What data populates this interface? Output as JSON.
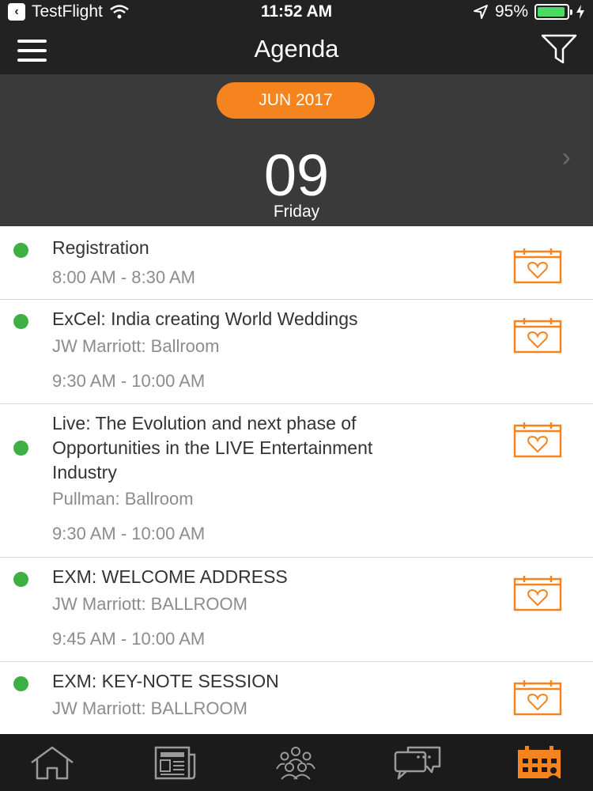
{
  "status_bar": {
    "carrier": "TestFlight",
    "time": "11:52 AM",
    "battery": "95%",
    "battery_level": 0.95,
    "icons": [
      "back-icon",
      "wifi-icon",
      "location-icon",
      "battery-icon",
      "charging-icon"
    ]
  },
  "header": {
    "title": "Agenda",
    "menu_icon": "hamburger-icon",
    "filter_icon": "funnel-icon"
  },
  "date_selector": {
    "month": "JUN 2017",
    "day": "09",
    "weekday": "Friday",
    "next_icon": "chevron-right-icon"
  },
  "agenda": [
    {
      "title": "Registration",
      "venue": "",
      "time": "8:00 AM - 8:30 AM"
    },
    {
      "title": "ExCel: India creating World Weddings",
      "venue": "JW Marriott: Ballroom",
      "time": "9:30 AM - 10:00 AM"
    },
    {
      "title_lines": [
        "Live: The Evolution and next phase of",
        "Opportunities in the LIVE Entertainment",
        "Industry"
      ],
      "venue": "Pullman: Ballroom",
      "time": "9:30 AM - 10:00 AM"
    },
    {
      "title": "EXM: WELCOME ADDRESS",
      "venue": "JW Marriott: BALLROOM",
      "time": "9:45 AM - 10:00 AM"
    },
    {
      "title": "EXM: KEY-NOTE SESSION",
      "venue": "JW Marriott: BALLROOM",
      "time": ""
    }
  ],
  "tabs": [
    {
      "icon": "home-icon",
      "active": false
    },
    {
      "icon": "newspaper-icon",
      "active": false
    },
    {
      "icon": "people-icon",
      "active": false
    },
    {
      "icon": "chat-icon",
      "active": false
    },
    {
      "icon": "calendar-icon",
      "active": true
    }
  ],
  "colors": {
    "accent": "#f5841f",
    "header_bg": "#222222",
    "date_bg": "#3a3a3a",
    "dot": "#3cb043",
    "tab_inactive": "#9a9a9a"
  }
}
